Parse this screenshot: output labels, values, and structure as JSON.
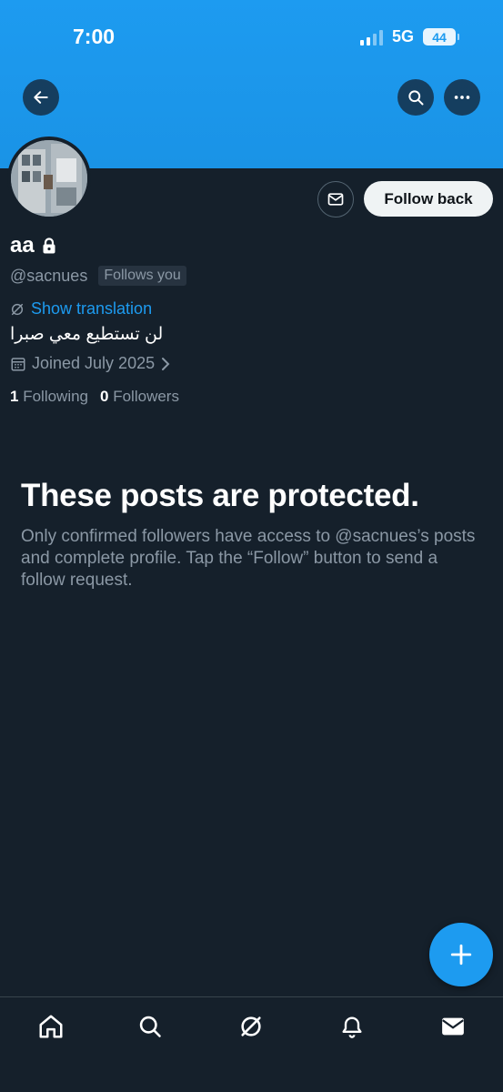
{
  "status_bar": {
    "time": "7:00",
    "network": "5G",
    "battery": "44"
  },
  "header": {
    "back_icon": "arrow-left-icon",
    "search_icon": "search-icon",
    "more_icon": "more-horizontal-icon"
  },
  "profile": {
    "name": "aa",
    "locked_icon": "lock-icon",
    "handle": "@sacnues",
    "follows_you": "Follows you",
    "show_translation": "Show translation",
    "bio": "لن تستطيع معي صبرا",
    "joined": "Joined July 2025",
    "following_count": "1",
    "following_label": "Following",
    "followers_count": "0",
    "followers_label": "Followers",
    "follow_button": "Follow back",
    "message_icon": "envelope-icon"
  },
  "protected": {
    "title": "These posts are protected.",
    "description": "Only confirmed followers have access to @sacnues’s posts and complete profile. Tap the “Follow” button to send a follow request."
  },
  "fab": {
    "icon": "plus-icon"
  },
  "bottom_nav": {
    "items": [
      "home-icon",
      "search-icon",
      "grok-icon",
      "bell-icon",
      "envelope-icon"
    ]
  },
  "colors": {
    "background": "#15202b",
    "accent": "#1d9bf0",
    "secondary_text": "#8b98a5"
  }
}
